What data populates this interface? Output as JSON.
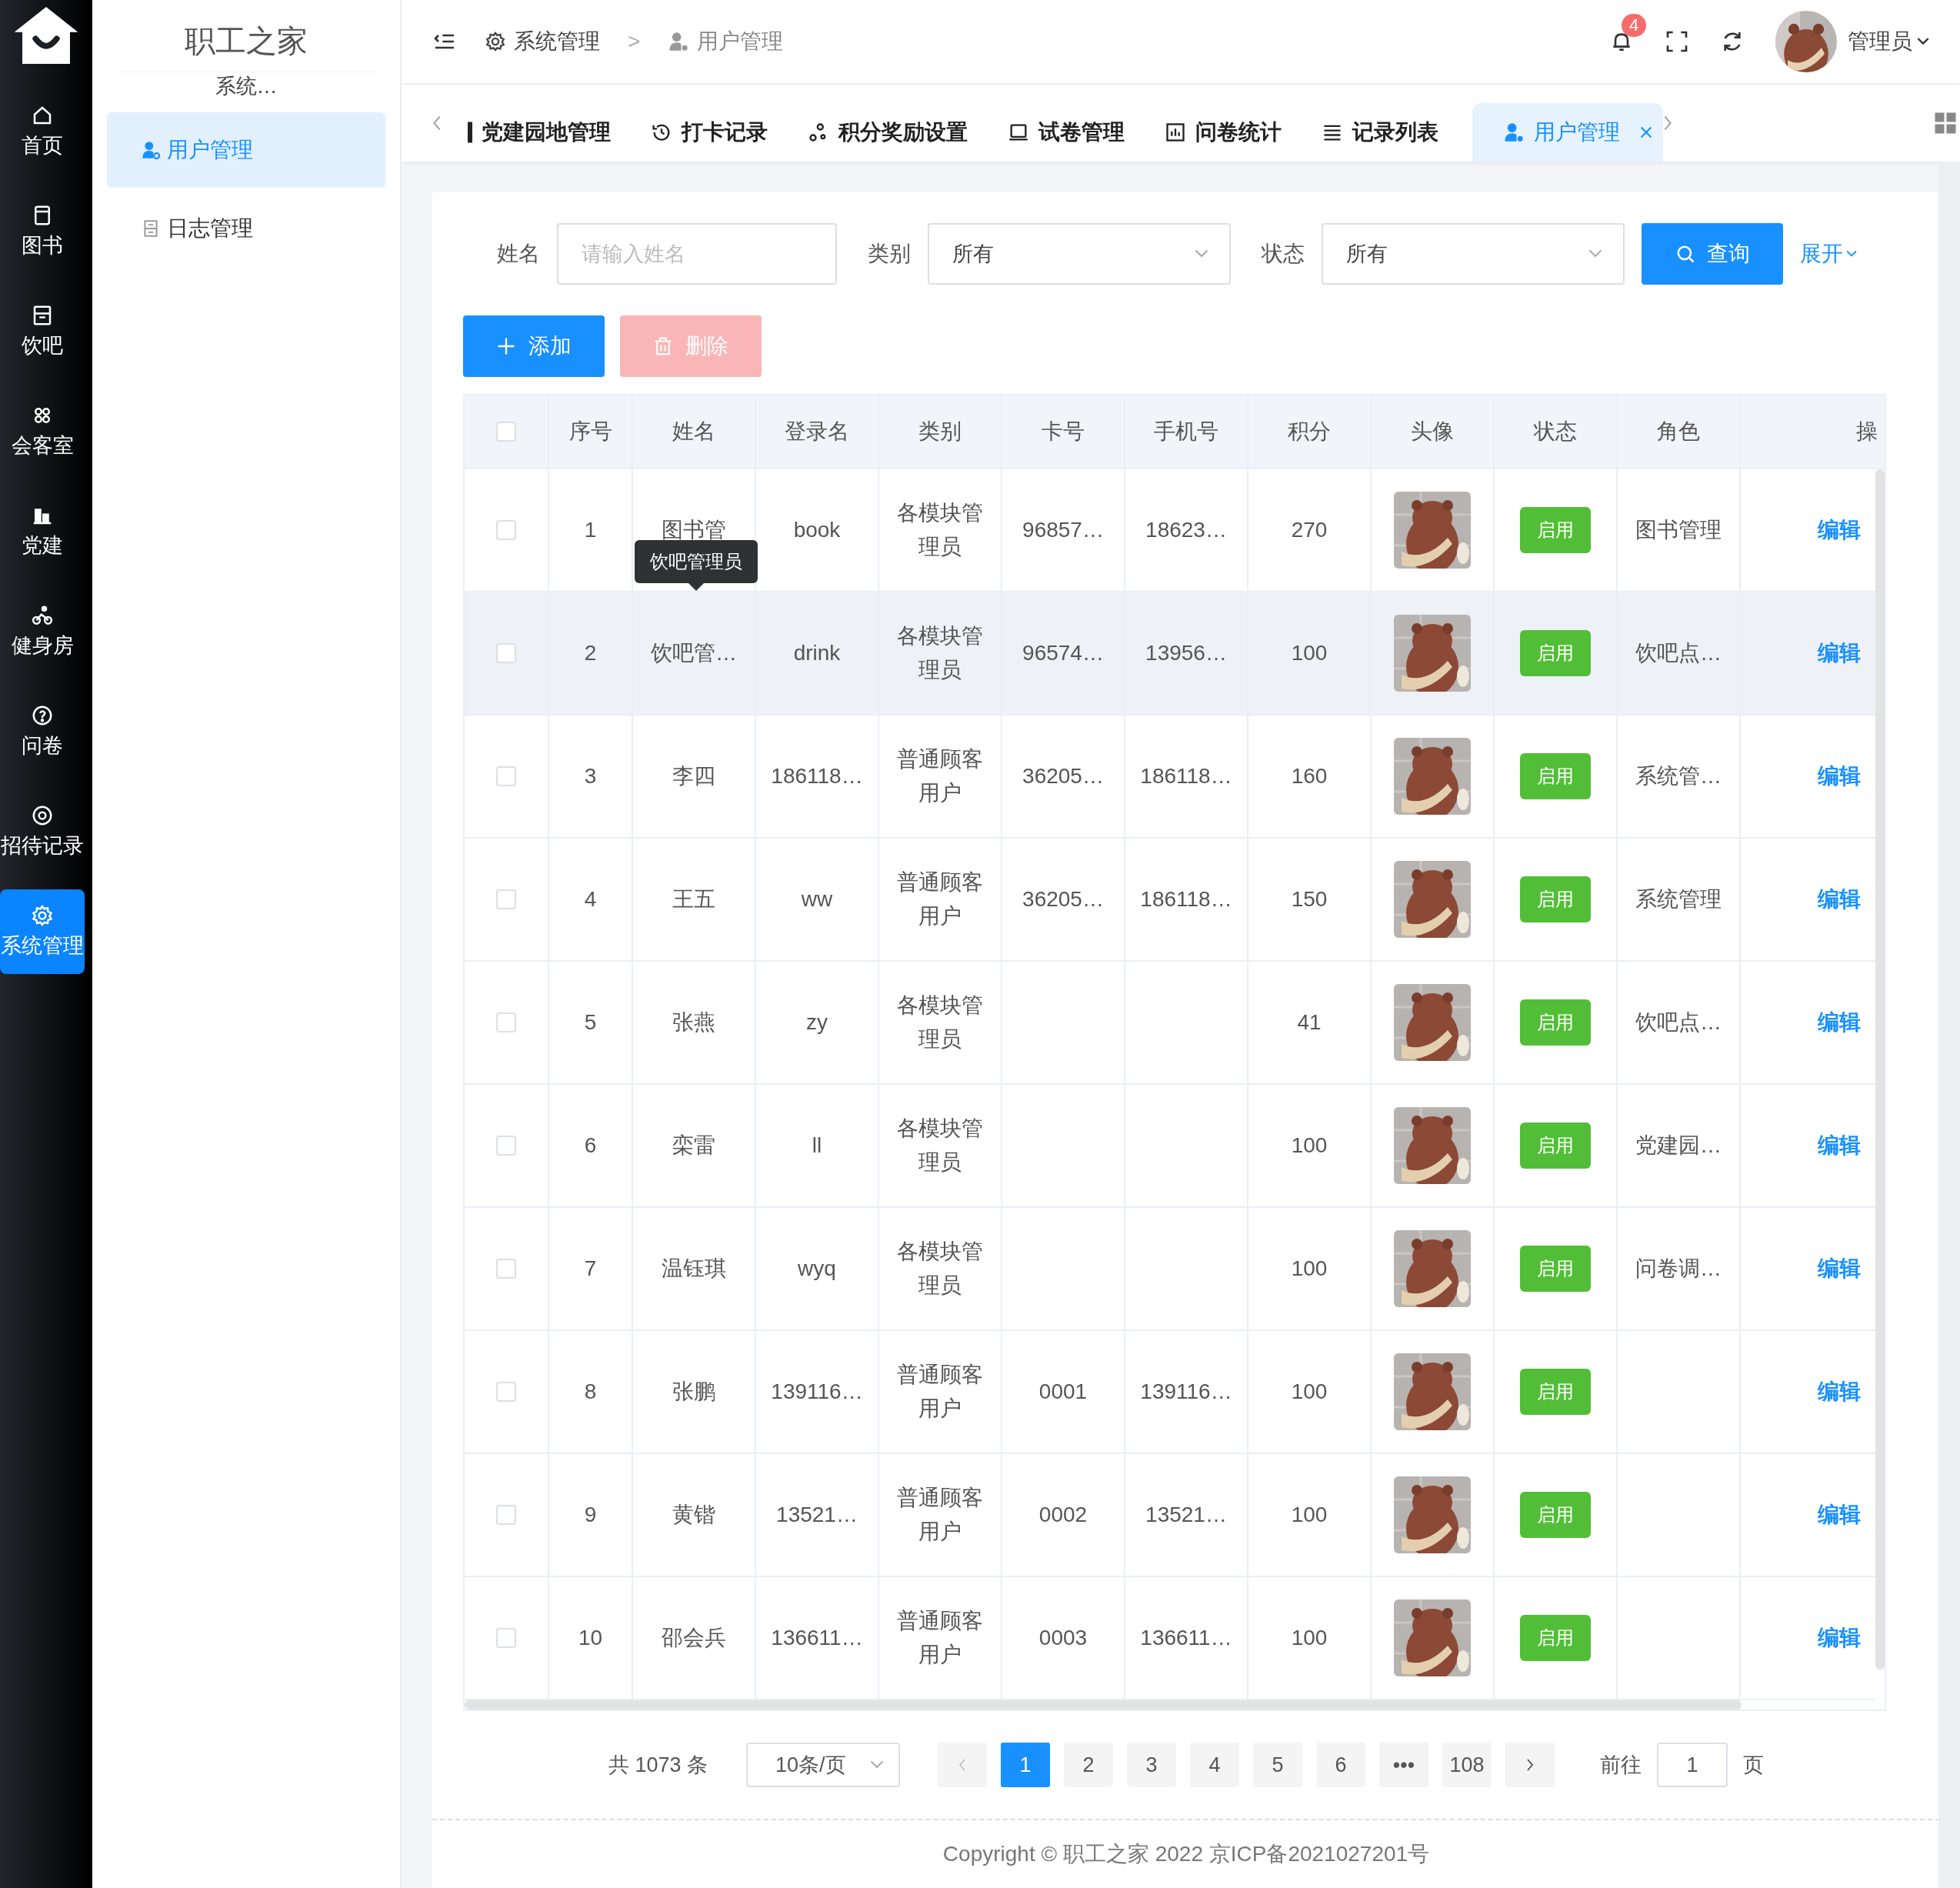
{
  "rail": {
    "items": [
      {
        "label": "首页",
        "selected": false
      },
      {
        "label": "图书",
        "selected": false
      },
      {
        "label": "饮吧",
        "selected": false
      },
      {
        "label": "会客室",
        "selected": false
      },
      {
        "label": "党建",
        "selected": false
      },
      {
        "label": "健身房",
        "selected": false
      },
      {
        "label": "问卷",
        "selected": false
      },
      {
        "label": "招待记录",
        "selected": false
      },
      {
        "label": "系统管理",
        "selected": true
      }
    ]
  },
  "sidebar": {
    "title": "职工之家",
    "subtitle": "系统…",
    "items": [
      {
        "label": "用户管理",
        "selected": true
      },
      {
        "label": "日志管理",
        "selected": false
      }
    ]
  },
  "header": {
    "breadcrumb": [
      "系统管理",
      "用户管理"
    ],
    "separator": ">",
    "notifications": "4",
    "user": "管理员"
  },
  "tabs": [
    {
      "label": "党建园地管理",
      "selected": false
    },
    {
      "label": "打卡记录",
      "selected": false
    },
    {
      "label": "积分奖励设置",
      "selected": false
    },
    {
      "label": "试卷管理",
      "selected": false
    },
    {
      "label": "问卷统计",
      "selected": false
    },
    {
      "label": "记录列表",
      "selected": false
    },
    {
      "label": "用户管理",
      "selected": true,
      "closable": true
    }
  ],
  "filters": {
    "name_label": "姓名",
    "name_placeholder": "请输入姓名",
    "category_label": "类别",
    "category_value": "所有",
    "status_label": "状态",
    "status_value": "所有",
    "search": "查询",
    "expand": "展开"
  },
  "actions": [
    {
      "label": "添加",
      "disabled": false
    },
    {
      "label": "删除",
      "disabled": true
    }
  ],
  "table": {
    "header_checked": false,
    "columns": [
      "序号",
      "姓名",
      "登录名",
      "类别",
      "卡号",
      "手机号",
      "积分",
      "头像",
      "状态",
      "角色",
      "操"
    ],
    "rows": [
      {
        "checked": false,
        "highlighted": false,
        "no": "1",
        "name": "图书管",
        "login": "book",
        "category": "各模块管理员",
        "card": "96857…",
        "phone": "18623…",
        "points": "270",
        "status": "启用",
        "role": "图书管理",
        "action": "编辑"
      },
      {
        "checked": false,
        "highlighted": true,
        "no": "2",
        "name": "饮吧管…",
        "login": "drink",
        "category": "各模块管理员",
        "card": "96574…",
        "phone": "13956…",
        "points": "100",
        "status": "启用",
        "role": "饮吧点…",
        "action": "编辑",
        "tooltip": "饮吧管理员"
      },
      {
        "checked": false,
        "highlighted": false,
        "no": "3",
        "name": "李四",
        "login": "186118…",
        "category": "普通顾客用户",
        "card": "36205…",
        "phone": "186118…",
        "points": "160",
        "status": "启用",
        "role": "系统管…",
        "action": "编辑"
      },
      {
        "checked": false,
        "highlighted": false,
        "no": "4",
        "name": "王五",
        "login": "ww",
        "category": "普通顾客用户",
        "card": "36205…",
        "phone": "186118…",
        "points": "150",
        "status": "启用",
        "role": "系统管理",
        "action": "编辑"
      },
      {
        "checked": false,
        "highlighted": false,
        "no": "5",
        "name": "张燕",
        "login": "zy",
        "category": "各模块管理员",
        "points": "41",
        "status": "启用",
        "role": "饮吧点…",
        "action": "编辑"
      },
      {
        "checked": false,
        "highlighted": false,
        "no": "6",
        "name": "栾雷",
        "login": "ll",
        "category": "各模块管理员",
        "points": "100",
        "status": "启用",
        "role": "党建园…",
        "action": "编辑"
      },
      {
        "checked": false,
        "highlighted": false,
        "no": "7",
        "name": "温钰琪",
        "login": "wyq",
        "category": "各模块管理员",
        "points": "100",
        "status": "启用",
        "role": "问卷调…",
        "action": "编辑"
      },
      {
        "checked": false,
        "highlighted": false,
        "no": "8",
        "name": "张鹏",
        "login": "139116…",
        "category": "普通顾客用户",
        "card": "0001",
        "phone": "139116…",
        "points": "100",
        "status": "启用",
        "action": "编辑"
      },
      {
        "checked": false,
        "highlighted": false,
        "no": "9",
        "name": "黄锴",
        "login": "13521…",
        "category": "普通顾客用户",
        "card": "0002",
        "phone": "13521…",
        "points": "100",
        "status": "启用",
        "action": "编辑"
      },
      {
        "checked": false,
        "highlighted": false,
        "no": "10",
        "name": "邵会兵",
        "login": "136611…",
        "category": "普通顾客用户",
        "card": "0003",
        "phone": "136611…",
        "points": "100",
        "status": "启用",
        "action": "编辑"
      }
    ]
  },
  "pagination": {
    "total": "共 1073 条",
    "page_size": "10条/页",
    "pages": [
      {
        "label": "1",
        "selected": true
      },
      {
        "label": "2",
        "selected": false
      },
      {
        "label": "3",
        "selected": false
      },
      {
        "label": "4",
        "selected": false
      },
      {
        "label": "5",
        "selected": false
      },
      {
        "label": "6",
        "selected": false
      },
      {
        "label": "•••",
        "selected": false
      },
      {
        "label": "108",
        "selected": false
      }
    ],
    "goto_label": "前往",
    "goto_value": "1",
    "page_label": "页"
  },
  "footer": "Copyright © 职工之家 2022 京ICP备2021027201号"
}
